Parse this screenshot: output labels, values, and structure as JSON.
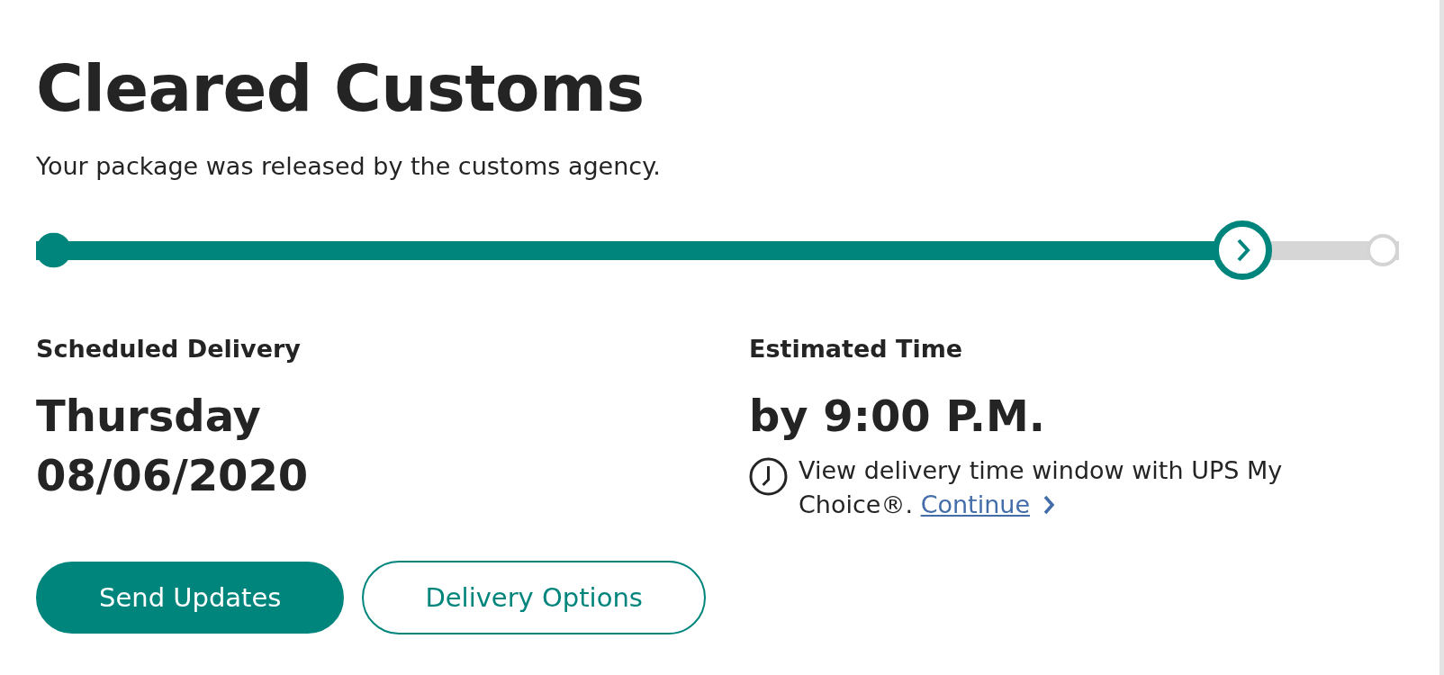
{
  "heading": {
    "title": "Cleared Customs",
    "subtitle": "Your package was released by the customs agency."
  },
  "progress": {
    "level": 0.885
  },
  "delivery": {
    "label": "Scheduled Delivery",
    "day": "Thursday",
    "date": "08/06/2020"
  },
  "estimate": {
    "label": "Estimated Time",
    "time": "by 9:00 P.M.",
    "note": "View delivery time window with UPS My Choice®.",
    "link": "Continue"
  },
  "buttons": [
    {
      "label": "Send Updates",
      "kind": "primary"
    },
    {
      "label": "Delivery Options",
      "kind": "secondary"
    }
  ]
}
